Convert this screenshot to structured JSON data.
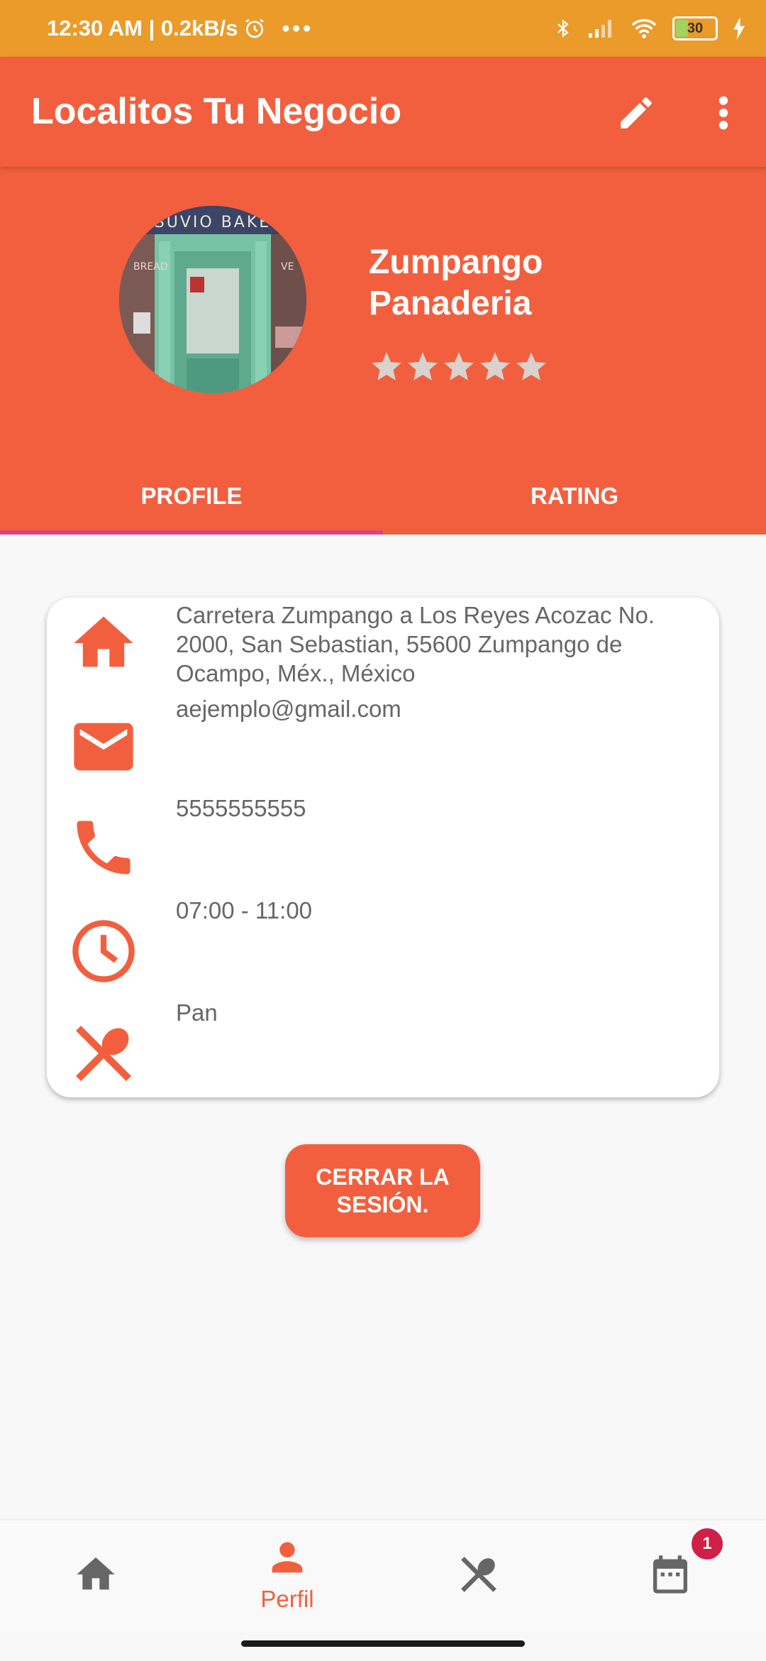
{
  "status_bar": {
    "time_speed": "12:30 AM | 0.2kB/s",
    "battery": "30"
  },
  "app_bar": {
    "title": "Localitos Tu Negocio"
  },
  "profile": {
    "name_line1": "Zumpango",
    "name_line2": "Panaderia",
    "rating_stars": 0,
    "rating_max": 5
  },
  "tabs": [
    {
      "label": "PROFILE",
      "active": true
    },
    {
      "label": "RATING",
      "active": false
    }
  ],
  "details": {
    "address": "Carretera Zumpango a Los Reyes Acozac No. 2000, San Sebastian, 55600 Zumpango de Ocampo, Méx., México",
    "email": "aejemplo@gmail.com",
    "phone": "5555555555",
    "hours": "07:00 - 11:00",
    "category": "Pan"
  },
  "logout": {
    "line1": "CERRAR LA",
    "line2": "SESIÓN."
  },
  "bottom_nav": {
    "profile_label": "Perfil",
    "calendar_badge": "1"
  },
  "colors": {
    "status_bar": "#ea9b2a",
    "primary": "#f25f3e",
    "tab_indicator": "#e5407d",
    "badge": "#d01f48"
  }
}
